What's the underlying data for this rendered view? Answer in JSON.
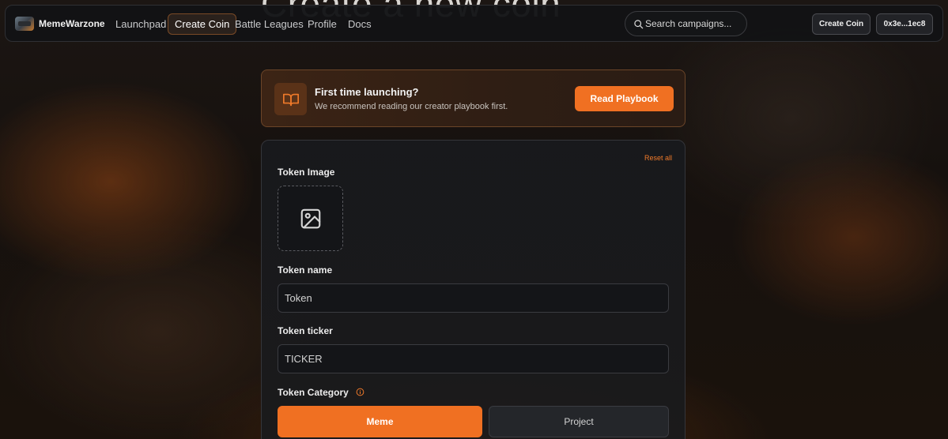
{
  "hero": {
    "title": "Create a new coin"
  },
  "navbar": {
    "brand": "MemeWarzone",
    "links": [
      {
        "label": "Launchpad",
        "active": false
      },
      {
        "label": "Create Coin",
        "active": true
      },
      {
        "label": "Battle Leagues",
        "active": false
      },
      {
        "label": "Profile",
        "active": false
      },
      {
        "label": "Docs",
        "active": false
      }
    ],
    "search": {
      "placeholder": "Search campaigns..."
    },
    "create_button": "Create Coin",
    "wallet_button": "0x3e...1ec8"
  },
  "banner": {
    "icon": "book-open-icon",
    "title": "First time launching?",
    "text": "We recommend reading our creator playbook first.",
    "button": "Read Playbook"
  },
  "form": {
    "reset": "Reset all",
    "image_label": "Token Image",
    "image_icon": "image-icon",
    "name_label": "Token name",
    "name_placeholder": "Token",
    "ticker_label": "Token ticker",
    "ticker_placeholder": "TICKER",
    "category_label": "Token Category",
    "category_icon": "info-icon",
    "categories": [
      {
        "label": "Meme",
        "selected": true
      },
      {
        "label": "Project",
        "selected": false
      }
    ]
  },
  "colors": {
    "accent": "#f07022",
    "background": "#16110e",
    "card": "#18191c"
  }
}
